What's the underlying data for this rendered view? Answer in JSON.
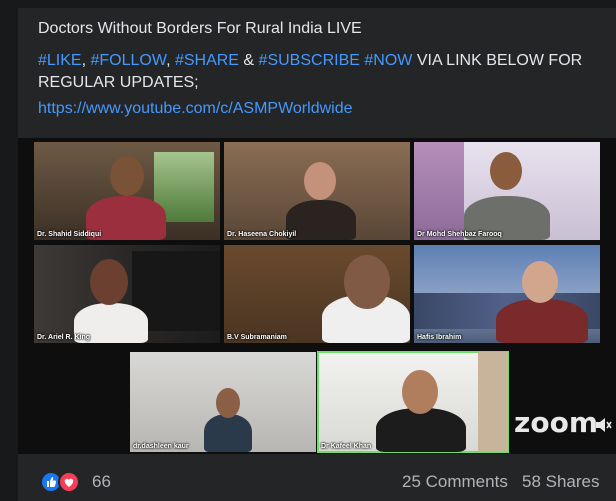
{
  "post": {
    "title": "Doctors Without Borders For Rural India LIVE",
    "hashtags_line": [
      {
        "text": "#LIKE",
        "tag": true
      },
      {
        "text": ", ",
        "tag": false
      },
      {
        "text": "#FOLLOW",
        "tag": true
      },
      {
        "text": ", ",
        "tag": false
      },
      {
        "text": "#SHARE",
        "tag": true
      },
      {
        "text": " & ",
        "tag": false
      },
      {
        "text": "#SUBSCRIBE",
        "tag": true
      },
      {
        "text": " ",
        "tag": false
      },
      {
        "text": "#NOW",
        "tag": true
      },
      {
        "text": " VIA LINK BELOW FOR REGULAR UPDATES;",
        "tag": false
      }
    ],
    "link": "https://www.youtube.com/c/ASMPWorldwide"
  },
  "video": {
    "participants": [
      {
        "name": "Dr. Shahid Siddiqui"
      },
      {
        "name": "Dr. Haseena Chokiyil"
      },
      {
        "name": "Dr Mohd Shehbaz Farooq"
      },
      {
        "name": "Dr. Ariel R. King"
      },
      {
        "name": "B.V Subramaniam"
      },
      {
        "name": "Hafis Ibrahim"
      },
      {
        "name": "dr.dashleen kaur"
      },
      {
        "name": "Dr Kafeel Khan"
      }
    ],
    "watermark": "zoom"
  },
  "reactions": {
    "count": "66",
    "icons": [
      "like-icon",
      "love-icon"
    ],
    "comments": "25 Comments",
    "shares": "58 Shares"
  },
  "colors": {
    "background": "#18191a",
    "card": "#242526",
    "link": "#4599ff",
    "active_speaker": "#6de06a"
  }
}
